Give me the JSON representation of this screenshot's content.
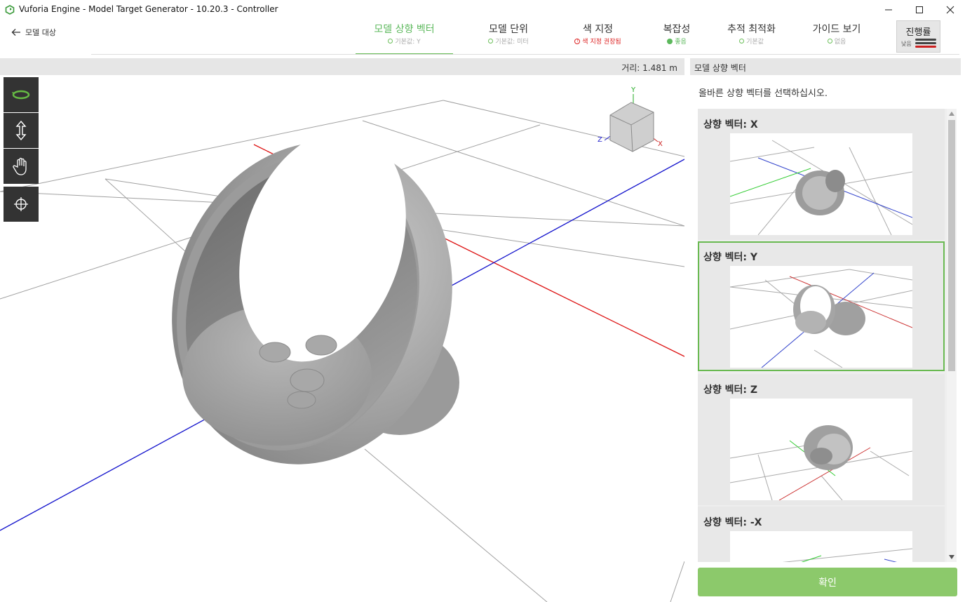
{
  "window": {
    "title": "Vuforia Engine - Model Target Generator - 10.20.3 - Controller"
  },
  "header": {
    "back_label": "모델 대상",
    "steps": [
      {
        "label": "모델 상향 벡터",
        "status": "기본값: Y",
        "state": "active"
      },
      {
        "label": "모델 단위",
        "status": "기본값: 미터",
        "state": "default"
      },
      {
        "label": "색 지정",
        "status": "색 지정 권장됨",
        "state": "warning"
      },
      {
        "label": "복잡성",
        "status": "좋음",
        "state": "good"
      },
      {
        "label": "추적 최적화",
        "status": "기본값",
        "state": "default"
      },
      {
        "label": "가이드 보기",
        "status": "없음",
        "state": "default"
      }
    ],
    "progress": {
      "title": "진행률",
      "level": "낮음"
    }
  },
  "viewport": {
    "distance": "거리: 1.481 m",
    "tools": [
      "orbit-icon",
      "zoom-icon",
      "pan-icon",
      "recenter-icon"
    ],
    "gizmo_labels": {
      "y": "Y",
      "z": "Z",
      "x": "X"
    }
  },
  "panel": {
    "title": "모델 상향 벡터",
    "instruction": "올바른 상향 벡터를 선택하십시오.",
    "options": [
      {
        "label": "상향 벡터: X"
      },
      {
        "label": "상향 벡터: Y",
        "selected": true
      },
      {
        "label": "상향 벡터: Z"
      },
      {
        "label": "상향 벡터: -X"
      }
    ],
    "confirm_label": "확인"
  },
  "colors": {
    "accent": "#5cb85c",
    "warning": "#dd2222",
    "confirm": "#8cc96b",
    "tool_bg": "#333333"
  }
}
